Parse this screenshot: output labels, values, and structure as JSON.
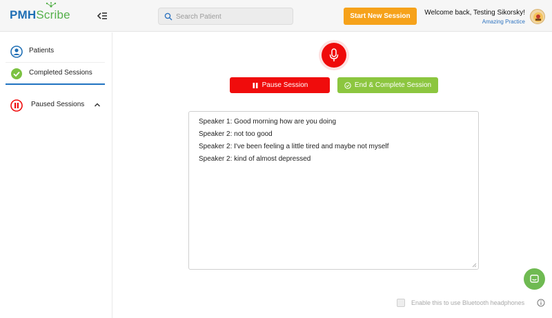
{
  "app": {
    "logo_pmh": "PMH",
    "logo_scribe": "Scribe"
  },
  "header": {
    "search_placeholder": "Search Patient",
    "start_button": "Start New Session",
    "welcome": "Welcome back, Testing Sikorsky!",
    "practice": "Amazing Practice"
  },
  "sidebar": {
    "items": [
      {
        "label": "Patients",
        "icon": "user-circle-icon"
      },
      {
        "label": "Completed Sessions",
        "icon": "check-circle-icon"
      },
      {
        "label": "Paused Sessions",
        "icon": "pause-circle-icon"
      }
    ]
  },
  "session": {
    "pause_button": "Pause Session",
    "end_button": "End & Complete Session",
    "transcript": [
      "Speaker 1: Good morning how are you doing",
      "Speaker 2: not too good",
      "Speaker 2: I've been feeling a little tired and maybe not myself",
      "Speaker 2: kind of almost depressed"
    ]
  },
  "footer": {
    "bluetooth_label": "Enable this to use Bluetooth headphones"
  },
  "colors": {
    "brand_blue": "#1f6fb5",
    "brand_green": "#55b04a",
    "accent_orange": "#f6a21a",
    "record_red": "#ef0b0b",
    "complete_green": "#8cc63f"
  }
}
